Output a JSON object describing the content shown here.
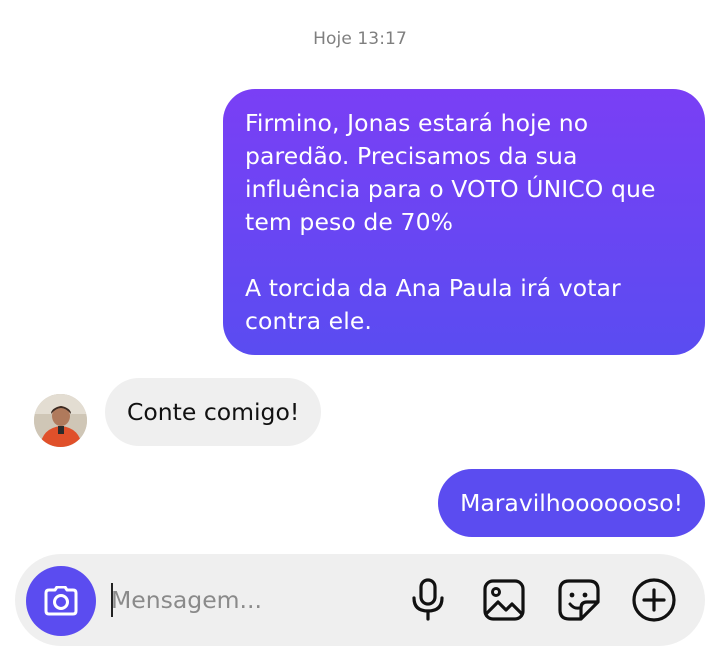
{
  "conversation": {
    "timestamp": "Hoje 13:17",
    "messages": [
      {
        "direction": "outgoing",
        "text": "Firmino, Jonas estará hoje no paredão. Precisamos da sua influência para o VOTO ÚNICO que tem peso de 70%\n\nA torcida da Ana Paula irá votar contra ele."
      },
      {
        "direction": "incoming",
        "text": "Conte comigo!"
      },
      {
        "direction": "outgoing",
        "text": "Maravilhooooooso!"
      }
    ]
  },
  "composer": {
    "placeholder": "Mensagem...",
    "value": "",
    "icons": {
      "camera": "camera-icon",
      "microphone": "microphone-icon",
      "gallery": "image-icon",
      "sticker": "sticker-icon",
      "add": "plus-circle-icon"
    }
  },
  "colors": {
    "outgoing_bubble_top": "#7a3ff5",
    "outgoing_bubble_bottom": "#5a4cf1",
    "incoming_bubble": "#efefef",
    "accent": "#5b4cf0",
    "composer_background": "#efefef"
  }
}
